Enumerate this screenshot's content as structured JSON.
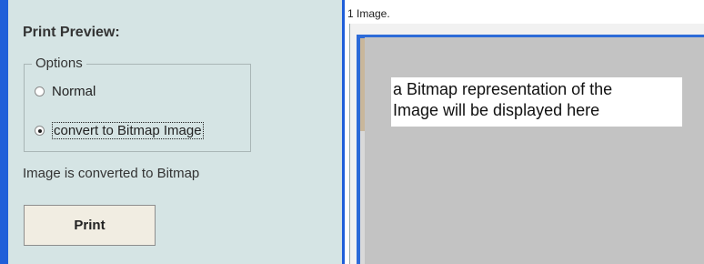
{
  "left_panel": {
    "title": "Print Preview:",
    "options": {
      "legend": "Options",
      "items": [
        {
          "label": "Normal",
          "checked": false
        },
        {
          "label": "convert to Bitmap Image",
          "checked": true
        }
      ]
    },
    "status": "Image is converted to Bitmap",
    "print_button": "Print"
  },
  "right_panel": {
    "image_caption": "1 Image.",
    "placeholder_text_line1": "a Bitmap representation of the",
    "placeholder_text_line2": "Image will be displayed here"
  },
  "colors": {
    "panel_bg": "#d5e4e4",
    "accent_blue": "#1f5fd9",
    "button_bg": "#f1ede2",
    "preview_gray": "#c3c3c3"
  }
}
